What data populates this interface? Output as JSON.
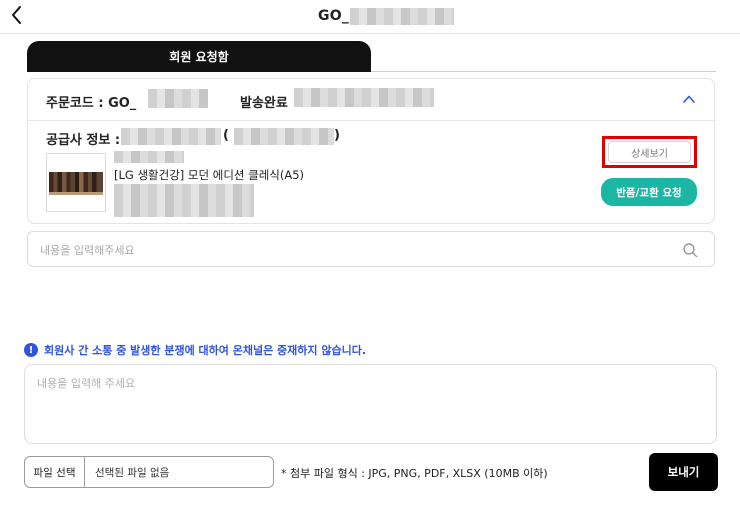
{
  "header": {
    "title_prefix": "GO_",
    "back_icon": "chevron-left-icon"
  },
  "tab": {
    "label": "회원 요청함"
  },
  "order": {
    "code_label": "주문코드 : GO_",
    "status_label": "발송완료",
    "collapse_icon": "chevron-up-icon",
    "supplier_label": "공급사 정보 :",
    "supplier_paren_open": "(",
    "supplier_paren_close": ")",
    "product_name": "[LG 생활건강] 모던 에디션 클레식(A5)",
    "detail_button": "상세보기",
    "return_button": "반품/교환 요청"
  },
  "search": {
    "placeholder": "내용을 입력해주세요",
    "icon": "search-icon"
  },
  "notice": {
    "icon": "info-icon",
    "text": "회원사 간 소통 중 발생한 분쟁에 대하여 온채널은 중재하지 않습니다."
  },
  "message": {
    "placeholder": "내용을 입력해 주세요"
  },
  "file": {
    "select_label": "파일 선택",
    "no_file_text": "선택된 파일 없음",
    "hint": "* 첨부 파일 형식 : JPG, PNG, PDF, XLSX (10MB 이하)"
  },
  "send_button": "보내기",
  "colors": {
    "accent_teal": "#1bb7a4",
    "notice_blue": "#2f55e0",
    "highlight_red": "#e00000",
    "tab_black": "#111111"
  }
}
